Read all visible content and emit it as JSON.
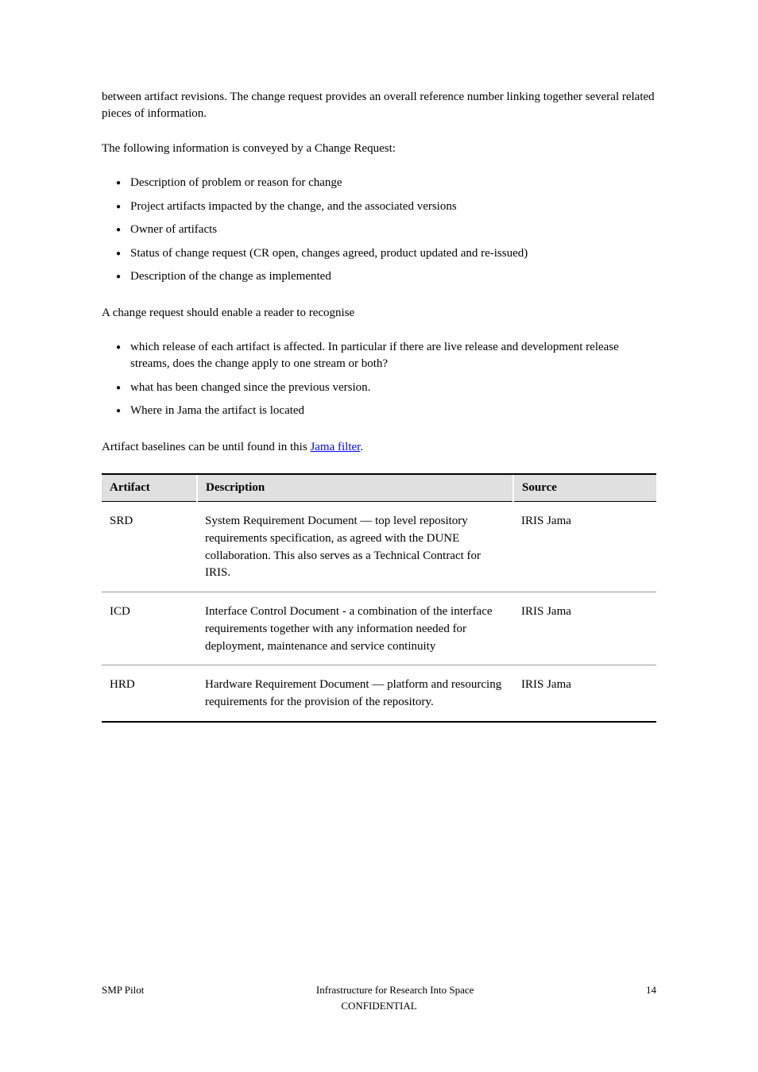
{
  "intro": {
    "p1": "between artifact revisions. The change request provides an overall reference number linking together several related pieces of information.",
    "p2": "The following information is conveyed by a Change Request:",
    "p3": "A change request should enable a reader to recognise"
  },
  "cr_items": {
    "i1": "Description of problem or reason for change",
    "i2": "Project artifacts impacted by the change, and the associated versions",
    "i3": "Owner of artifacts",
    "i4": "Status of change request (CR open, changes agreed, product updated and re-issued)",
    "i5": "Description of the change as implemented"
  },
  "enable_items": {
    "e1": "which release of each artifact is affected. In particular if there are live release and development release streams, does the change apply to one stream or both?",
    "e2": "what has been changed since the previous version.",
    "e3": "Where in Jama the artifact is located"
  },
  "table": {
    "caption_prefix": "Artifact baselines can be until found in this",
    "caption_link": "Jama filter",
    "caption_suffix": ".",
    "headers": {
      "artifact": "Artifact",
      "description": "Description",
      "source": "Source"
    },
    "rows": [
      {
        "artifact": "SRD",
        "description": "System Requirement Document — top level repository requirements specification, as agreed with the DUNE collaboration. This also serves as a Technical Contract for IRIS.",
        "source": "IRIS Jama"
      },
      {
        "artifact": "ICD",
        "description": "Interface Control Document - a combination of the interface requirements together with any information needed for deployment, maintenance and service continuity",
        "source": "IRIS Jama"
      },
      {
        "artifact": "HRD",
        "description": "Hardware Requirement Document — platform and resourcing requirements for the provision of the repository.",
        "source": "IRIS Jama"
      }
    ]
  },
  "footer": {
    "left": "SMP Pilot",
    "center_line1": "Infrastructure for Research Into Space",
    "center_line2": "CONFIDENTIAL",
    "right": "14"
  }
}
